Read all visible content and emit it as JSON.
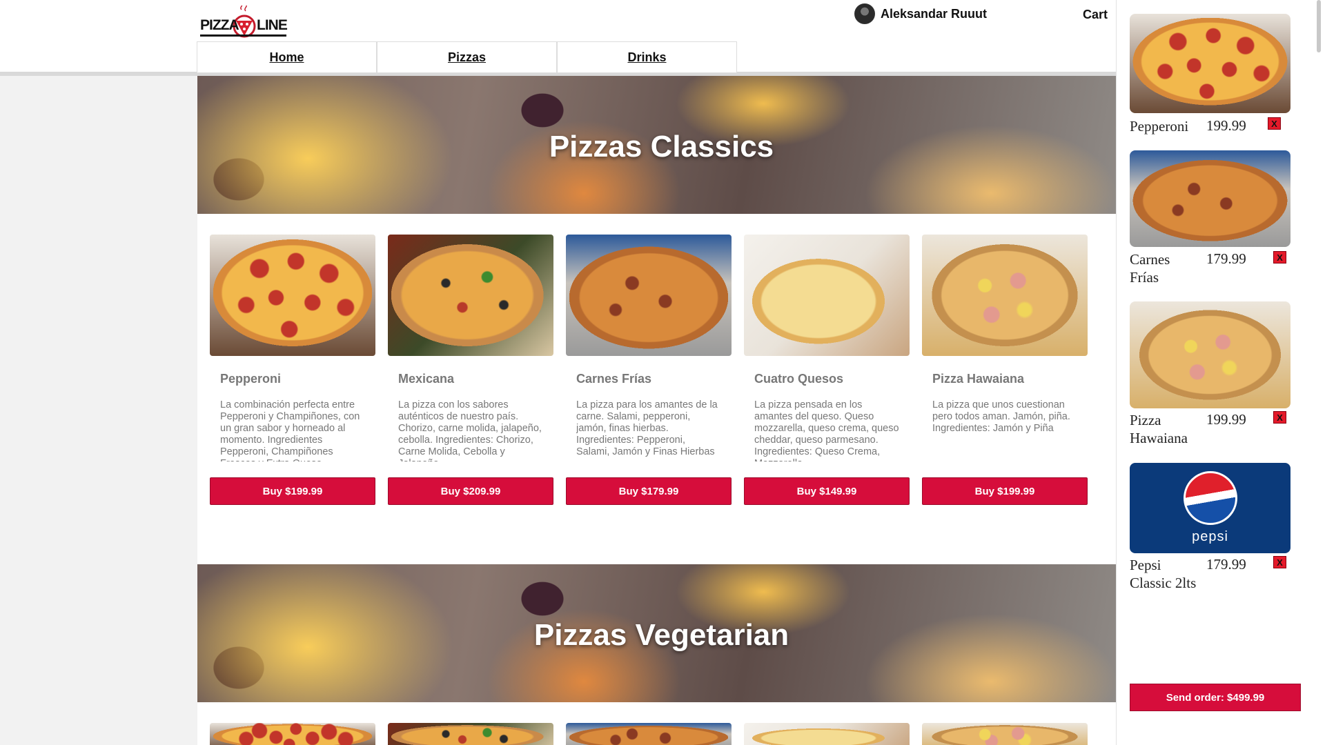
{
  "brand": {
    "logo_text_left": "PIZZA",
    "logo_text_right": "LINE"
  },
  "nav": {
    "items": [
      {
        "label": "Home"
      },
      {
        "label": "Pizzas"
      },
      {
        "label": "Drinks"
      }
    ]
  },
  "user": {
    "name": "Aleksandar Ruuut"
  },
  "header": {
    "cart_label": "Cart"
  },
  "sections": [
    {
      "title": "Pizzas Classics",
      "products": [
        {
          "name": "Pepperoni",
          "description": "La combinación perfecta entre Pepperoni y Champiñones, con un gran sabor y horneado al momento. Ingredientes Pepperoni, Champiñones Frescos y Extra Queso",
          "button": "Buy $199.99",
          "image": "pepperoni-pizza"
        },
        {
          "name": "Mexicana",
          "description": "La pizza con los sabores auténticos de nuestro país. Chorizo, carne molida, jalapeño, cebolla. Ingredientes: Chorizo, Carne Molida, Cebolla y Jalapeño",
          "button": "Buy $209.99",
          "image": "mexicana-pizza"
        },
        {
          "name": "Carnes Frías",
          "description": "La pizza para los amantes de la carne. Salami, pepperoni, jamón, finas hierbas. Ingredientes: Pepperoni, Salami, Jamón y Finas Hierbas",
          "button": "Buy $179.99",
          "image": "carnes-frias-pizza"
        },
        {
          "name": "Cuatro Quesos",
          "description": "La pizza pensada en los amantes del queso. Queso mozzarella, queso crema, queso cheddar, queso parmesano. Ingredientes: Queso Crema, Mozzarella,",
          "button": "Buy $149.99",
          "image": "cuatro-quesos-pizza"
        },
        {
          "name": "Pizza Hawaiana",
          "description": "La pizza que unos cuestionan pero todos aman. Jamón, piña. Ingredientes: Jamón y Piña",
          "button": "Buy $199.99",
          "image": "hawaiana-pizza"
        }
      ]
    },
    {
      "title": "Pizzas Vegetarian"
    }
  ],
  "cart": {
    "items": [
      {
        "name": "Pepperoni",
        "price": "199.99",
        "remove": "X",
        "image": "pepperoni-pizza"
      },
      {
        "name": "Carnes Frías",
        "price": "179.99",
        "remove": "X",
        "image": "carnes-frias-pizza"
      },
      {
        "name": "Pizza Hawaiana",
        "price": "199.99",
        "remove": "X",
        "image": "hawaiana-pizza"
      },
      {
        "name": "Pepsi Classic 2lts",
        "price": "179.99",
        "remove": "X",
        "image": "pepsi-bottle"
      }
    ],
    "pepsi_logo_text": "pepsi",
    "send_order": "Send order: $499.99"
  },
  "colors": {
    "accent": "#d60d3b",
    "remove": "#e41a2a",
    "text_muted": "#777777"
  }
}
